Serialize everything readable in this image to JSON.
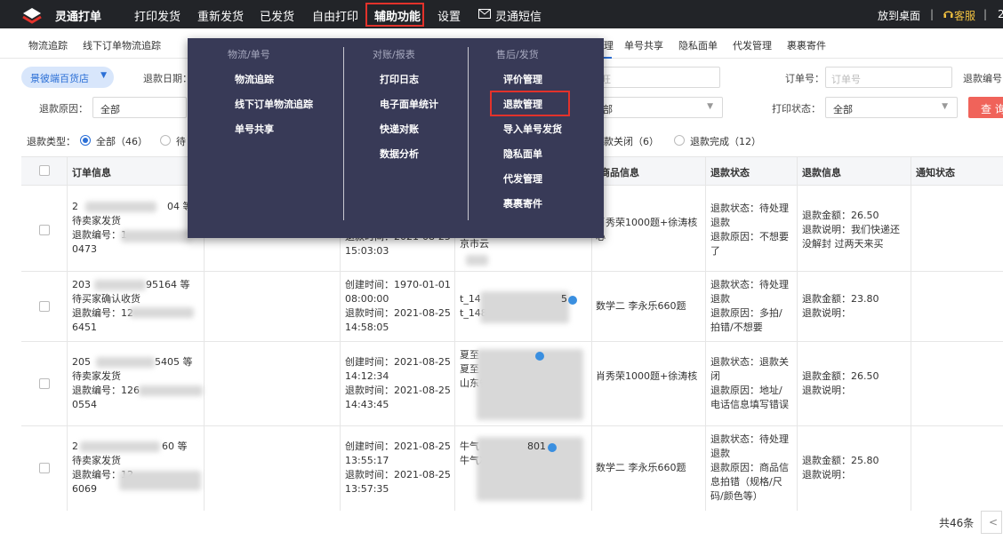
{
  "app": {
    "title": "灵通打单",
    "nav": [
      "打印发货",
      "重新发货",
      "已发货",
      "自由打印",
      "辅助功能",
      "设置",
      "灵通短信"
    ],
    "right": {
      "desktop": "放到桌面",
      "service": "客服",
      "extra": "2"
    }
  },
  "subnav": {
    "items": [
      "物流追踪",
      "线下订单物流追踪"
    ],
    "right_items": [
      "理",
      "单号共享",
      "隐私面单",
      "代发管理",
      "裹裹寄件"
    ]
  },
  "filters": {
    "shop": "景彼端百货店",
    "refund_date_label": "退款日期：",
    "wangwang_placeholder": "旺",
    "order_no_label": "订单号：",
    "order_no_placeholder": "订单号",
    "refund_no_label": "退款编号",
    "reason_label": "退款原因：",
    "reason_value": "全部",
    "mid_select_value": "部",
    "print_status_label": "打印状态：",
    "print_status_value": "全部",
    "query_button": "查 询"
  },
  "refund_types": {
    "label": "退款类型：",
    "options": [
      {
        "label": "全部（46）",
        "checked": true
      },
      {
        "label": "待",
        "checked": false
      },
      {
        "label": "款关闭（6）",
        "checked": false
      },
      {
        "label": "退款完成（12）",
        "checked": false
      }
    ]
  },
  "table": {
    "headers": [
      "订单信息",
      "商品信息",
      "退款状态",
      "退款信息",
      "通知状态"
    ],
    "rows": [
      {
        "order": "2\n待卖家发货\n退款编号：1\n0473",
        "order_suffix": "04 等",
        "time": "退款时间：2021-08-25\n15:03:03",
        "buyer": "京市云\n",
        "product": "",
        "status": "退款状态：待处理\n退款\n退款原因：不想要\n了",
        "info": "退款金额：26.50\n退款说明：我们快递还\n没解封 过两天来买"
      },
      {
        "order": "203\n待买家确认收货\n退款编号：12\n6451",
        "order_suffix": "95164 等",
        "time": "创建时间：1970-01-01\n08:00:00\n退款时间：2021-08-25\n14:58:05",
        "buyer": "t_14\nt_148",
        "product": "数学二 李永乐660题",
        "status": "退款状态：待处理\n退款\n退款原因：多拍/\n拍错/不想要",
        "info": "退款金额：23.80\n退款说明："
      },
      {
        "order": "205\n待卖家发货\n退款编号：126\n0554",
        "order_suffix": "5405 等",
        "time": "创建时间：2021-08-25\n14:12:34\n退款时间：2021-08-25\n14:43:45",
        "buyer": "夏至\n夏至\n山东省",
        "product": "肖秀荣1000题+徐涛核",
        "status": "退款状态：退款关\n闭\n退款原因：地址/\n电话信息填写错误",
        "info": "退款金额：26.50\n退款说明："
      },
      {
        "order": "2\n待卖家发货\n退款编号：12\n6069",
        "order_suffix": "60 等",
        "time": "创建时间：2021-08-25\n13:55:17\n退款时间：2021-08-25\n13:57:35",
        "buyer": "牛气\n牛气冲",
        "product": "数学二 李永乐660题",
        "status": "退款状态：待处理\n退款\n退款原因：商品信\n息拍错（规格/尺\n码/颜色等）",
        "info": "退款金额：25.80\n退款说明："
      }
    ],
    "row0_product_top": "肖秀荣1000题+徐涛核",
    "row0_product_bottom": "心",
    "row0_buyer_suffix": "801",
    "row1_buyer_suffix": "5",
    "row2_buyer_suffix": "1070"
  },
  "footer": {
    "total": "共46条",
    "prev": "<"
  },
  "dropdown": {
    "columns": [
      {
        "heading": "物流/单号",
        "items": [
          "物流追踪",
          "线下订单物流追踪",
          "单号共享"
        ]
      },
      {
        "heading": "对账/报表",
        "items": [
          "打印日志",
          "电子面单统计",
          "快递对账",
          "数据分析"
        ]
      },
      {
        "heading": "售后/发货",
        "items": [
          "评价管理",
          "退款管理",
          "导入单号发货",
          "隐私面单",
          "代发管理",
          "裹裹寄件"
        ]
      }
    ]
  },
  "colors": {
    "topbar": "#222428",
    "dropdown": "#383a57",
    "accent": "#2b6fd6",
    "highlight": "#e3322b",
    "query": "#f0635a"
  }
}
